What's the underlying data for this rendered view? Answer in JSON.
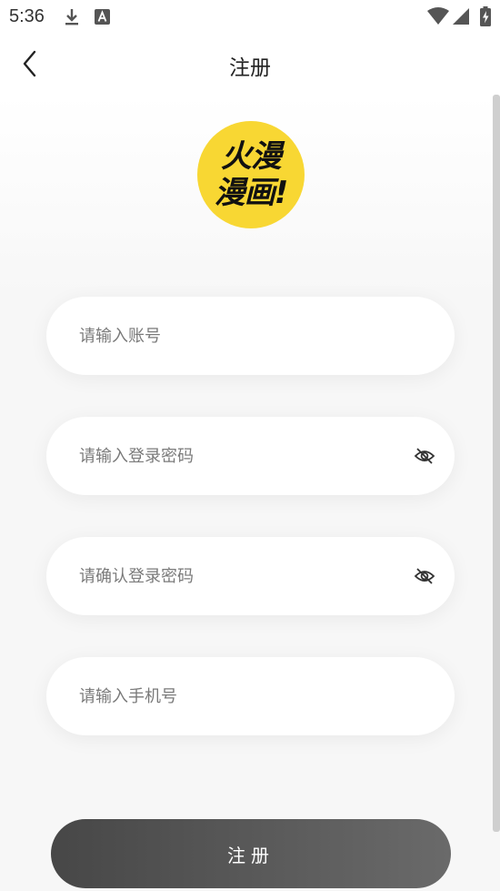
{
  "status_bar": {
    "time": "5:36",
    "icons": [
      "download-icon",
      "keyboard-a-icon",
      "wifi-icon",
      "signal-icon",
      "battery-charging-icon"
    ]
  },
  "header": {
    "title": "注册",
    "back_icon": "chevron-left-icon"
  },
  "logo": {
    "line1": "火漫",
    "line2": "漫画!",
    "bg_color": "#f8d733"
  },
  "form": {
    "account_placeholder": "请输入账号",
    "password_placeholder": "请输入登录密码",
    "confirm_password_placeholder": "请确认登录密码",
    "phone_placeholder": "请输入手机号",
    "visibility_icon": "eye-off-icon"
  },
  "actions": {
    "register_label": "注册"
  },
  "colors": {
    "button": "#555555",
    "logo_yellow": "#f8d733",
    "background": "#f7f7f7"
  }
}
